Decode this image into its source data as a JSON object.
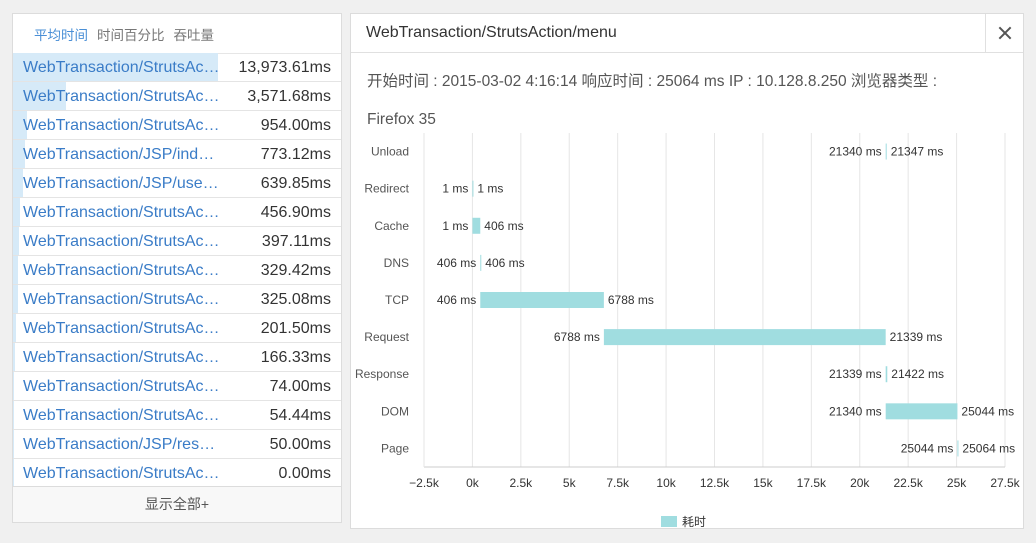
{
  "tabs": [
    "平均时间",
    "时间百分比",
    "吞吐量"
  ],
  "transactions": [
    {
      "name": "WebTransaction/StrutsAction/menu",
      "value": "13,973.61ms",
      "fraction": 0.62
    },
    {
      "name": "WebTransaction/StrutsAction/list",
      "value": "3,571.68ms",
      "fraction": 0.16
    },
    {
      "name": "WebTransaction/StrutsAction/user",
      "value": "954.00ms",
      "fraction": 0.043
    },
    {
      "name": "WebTransaction/JSP/index.jsp",
      "value": "773.12ms",
      "fraction": 0.035
    },
    {
      "name": "WebTransaction/JSP/user.jsp",
      "value": "639.85ms",
      "fraction": 0.029
    },
    {
      "name": "WebTransaction/StrutsAction/save",
      "value": "456.90ms",
      "fraction": 0.021
    },
    {
      "name": "WebTransaction/StrutsAction/edit",
      "value": "397.11ms",
      "fraction": 0.018
    },
    {
      "name": "WebTransaction/StrutsAction/view",
      "value": "329.42ms",
      "fraction": 0.015
    },
    {
      "name": "WebTransaction/StrutsAction/query",
      "value": "325.08ms",
      "fraction": 0.015
    },
    {
      "name": "WebTransaction/StrutsAction/login",
      "value": "201.50ms",
      "fraction": 0.009
    },
    {
      "name": "WebTransaction/StrutsAction/logout",
      "value": "166.33ms",
      "fraction": 0.007
    },
    {
      "name": "WebTransaction/StrutsAction/search",
      "value": "74.00ms",
      "fraction": 0.003
    },
    {
      "name": "WebTransaction/StrutsAction/delete",
      "value": "54.44ms",
      "fraction": 0.002
    },
    {
      "name": "WebTransaction/JSP/result.jsp",
      "value": "50.00ms",
      "fraction": 0.002
    },
    {
      "name": "WebTransaction/StrutsAction/home",
      "value": "0.00ms",
      "fraction": 0
    }
  ],
  "show_all": "显示全部+",
  "detail": {
    "title": "WebTransaction/StrutsAction/menu",
    "info": "开始时间 : 2015-03-02 4:16:14 响应时间 : 25064 ms IP : 10.128.8.250 浏览器类型 : Firefox 35"
  },
  "chart_data": {
    "type": "bar",
    "orientation": "horizontal-floating",
    "categories": [
      "Unload",
      "Redirect",
      "Cache",
      "DNS",
      "TCP",
      "Request",
      "Response",
      "DOM",
      "Page"
    ],
    "start": [
      21340,
      1,
      1,
      406,
      406,
      6788,
      21339,
      21340,
      25044
    ],
    "end": [
      21347,
      1,
      406,
      406,
      6788,
      21339,
      21422,
      25044,
      25064
    ],
    "start_labels": [
      "21340 ms",
      "1 ms",
      "1 ms",
      "406 ms",
      "406 ms",
      "6788 ms",
      "21339 ms",
      "21340 ms",
      "25044 ms"
    ],
    "end_labels": [
      "21347 ms",
      "1 ms",
      "406 ms",
      "406 ms",
      "6788 ms",
      "21339 ms",
      "21422 ms",
      "25044 ms",
      "25064 ms"
    ],
    "xlim": [
      -2500,
      27500
    ],
    "xticks": [
      -2500,
      0,
      2500,
      5000,
      7500,
      10000,
      12500,
      15000,
      17500,
      20000,
      22500,
      25000,
      27500
    ],
    "xtick_labels": [
      "−2.5k",
      "0k",
      "2.5k",
      "5k",
      "7.5k",
      "10k",
      "12.5k",
      "15k",
      "17.5k",
      "20k",
      "22.5k",
      "25k",
      "27.5k"
    ],
    "legend": "耗时",
    "bar_color": "#a0dde0",
    "grid": true
  }
}
